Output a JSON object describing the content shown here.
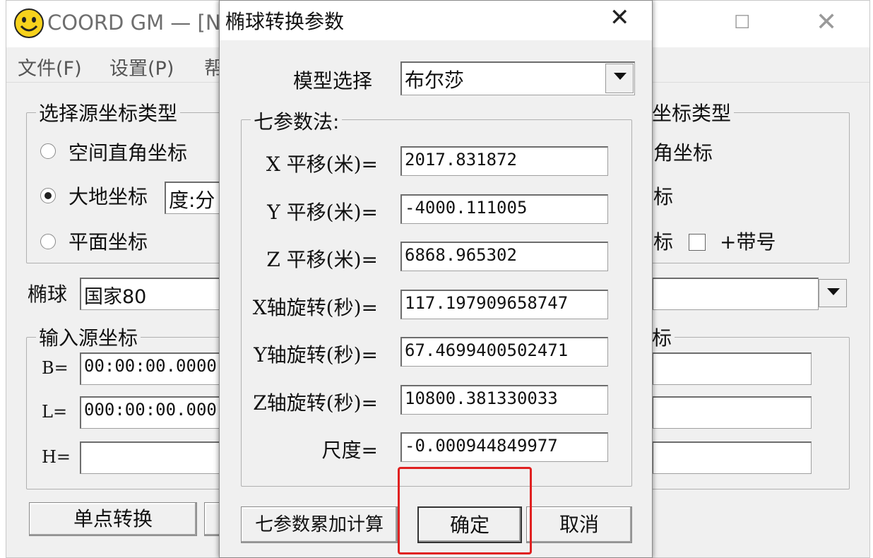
{
  "main_window": {
    "title": "COORD GM — [N",
    "menu": [
      "文件(F)",
      "设置(P)",
      "帮"
    ],
    "source_type_group": {
      "title": "选择源坐标类型",
      "options": [
        "空间直角坐标",
        "大地坐标",
        "平面坐标"
      ],
      "selected": "大地坐标",
      "format_value": "度:分"
    },
    "ellipsoid_label": "椭球",
    "ellipsoid_value": "国家80",
    "input_group": {
      "title": "输入源坐标",
      "fields": [
        {
          "label": "B=",
          "value": "00:00:00.0000"
        },
        {
          "label": "L=",
          "value": "000:00:00.000"
        },
        {
          "label": "H=",
          "value": ""
        }
      ]
    },
    "single_convert_button": "单点转换",
    "target_type_group": {
      "title": "坐标类型",
      "options": [
        "角坐标",
        "标",
        "标"
      ],
      "checkbox_label": "+带号"
    },
    "target_coords_title": "标"
  },
  "dialog": {
    "title": "椭球转换参数",
    "model_label": "模型选择",
    "model_value": "布尔莎",
    "group_title": "七参数法:",
    "params": [
      {
        "label": "X 平移(米)=",
        "value": "2017.831872"
      },
      {
        "label": "Y 平移(米)=",
        "value": "-4000.111005"
      },
      {
        "label": "Z 平移(米)=",
        "value": "6868.965302"
      },
      {
        "label": "X轴旋转(秒)=",
        "value": "117.197909658747"
      },
      {
        "label": "Y轴旋转(秒)=",
        "value": "67.4699400502471"
      },
      {
        "label": "Z轴旋转(秒)=",
        "value": "10800.381330033"
      },
      {
        "label": "尺度=",
        "value": "-0.000944849977"
      }
    ],
    "buttons": {
      "accumulate": "七参数累加计算",
      "ok": "确定",
      "cancel": "取消"
    },
    "highlight_color": "#e02020"
  }
}
